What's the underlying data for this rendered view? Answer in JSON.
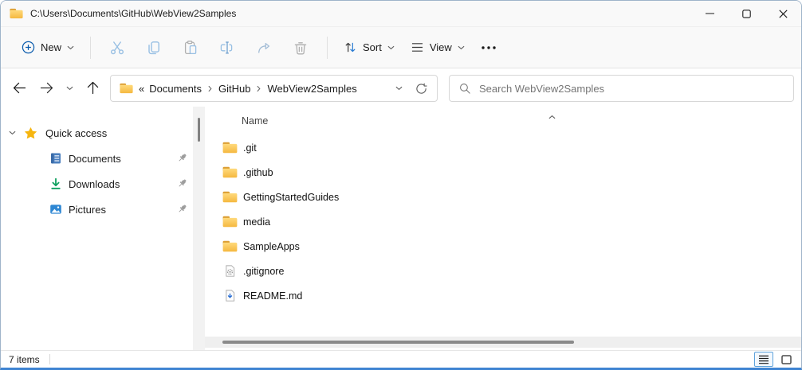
{
  "window": {
    "title": "C:\\Users\\Documents\\GitHub\\WebView2Samples"
  },
  "toolbar": {
    "new_label": "New",
    "sort_label": "Sort",
    "view_label": "View"
  },
  "navbar": {
    "breadcrumb_overflow": "«",
    "breadcrumb": [
      "Documents",
      "GitHub",
      "WebView2Samples"
    ],
    "search_placeholder": "Search WebView2Samples"
  },
  "sidebar": {
    "quick_access_label": "Quick access",
    "items": [
      {
        "label": "Documents",
        "icon": "documents-icon",
        "pinned": true
      },
      {
        "label": "Downloads",
        "icon": "downloads-icon",
        "pinned": true
      },
      {
        "label": "Pictures",
        "icon": "pictures-icon",
        "pinned": true
      }
    ]
  },
  "filelist": {
    "column_header": "Name",
    "sort": "ascending",
    "items": [
      {
        "name": ".git",
        "icon": "folder"
      },
      {
        "name": ".github",
        "icon": "folder"
      },
      {
        "name": "GettingStartedGuides",
        "icon": "folder"
      },
      {
        "name": "media",
        "icon": "folder"
      },
      {
        "name": "SampleApps",
        "icon": "folder"
      },
      {
        "name": ".gitignore",
        "icon": "config-file"
      },
      {
        "name": "README.md",
        "icon": "markdown-file"
      }
    ]
  },
  "statusbar": {
    "items_count": "7 items"
  },
  "colors": {
    "accent_blue": "#0b5cad",
    "window_border_bottom": "#3f84d2",
    "folder_amber_top": "#dc9e33",
    "folder_amber_front": "#fcc95b",
    "disabled_icon_blue": "#97bfe3",
    "disabled_icon_gray": "#b0b0b0",
    "star_gold": "#f6b50f",
    "downloads_green": "#0fa05f",
    "pictures_blue": "#2e87d3",
    "documents_blue": "#4b7fbe"
  }
}
